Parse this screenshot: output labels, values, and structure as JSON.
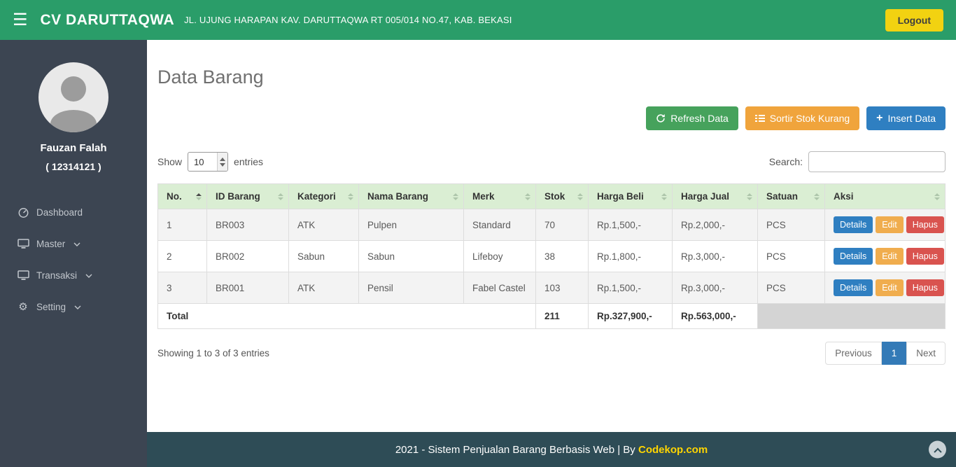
{
  "navbar": {
    "brand": "CV DARUTTAQWA",
    "subtitle": "JL. UJUNG HARAPAN KAV. DARUTTAQWA RT 005/014 NO.47, KAB. BEKASI",
    "logout_label": "Logout"
  },
  "sidebar": {
    "user_name": "Fauzan Falah",
    "user_id": "( 12314121 )",
    "items": [
      {
        "label": "Dashboard"
      },
      {
        "label": "Master"
      },
      {
        "label": "Transaksi"
      },
      {
        "label": "Setting"
      }
    ]
  },
  "main": {
    "page_title": "Data Barang",
    "buttons": {
      "refresh": "Refresh Data",
      "sortir": "Sortir Stok Kurang",
      "insert": "Insert Data"
    },
    "controls": {
      "show_label": "Show",
      "page_length": "10",
      "entries_label": "entries",
      "search_label": "Search:"
    },
    "table": {
      "headers": [
        "No.",
        "ID Barang",
        "Kategori",
        "Nama Barang",
        "Merk",
        "Stok",
        "Harga Beli",
        "Harga Jual",
        "Satuan",
        "Aksi"
      ],
      "rows": [
        {
          "no": "1",
          "id": "BR003",
          "kategori": "ATK",
          "nama": "Pulpen",
          "merk": "Standard",
          "stok": "70",
          "beli": "Rp.1,500,-",
          "jual": "Rp.2,000,-",
          "satuan": "PCS"
        },
        {
          "no": "2",
          "id": "BR002",
          "kategori": "Sabun",
          "nama": "Sabun",
          "merk": "Lifeboy",
          "stok": "38",
          "beli": "Rp.1,800,-",
          "jual": "Rp.3,000,-",
          "satuan": "PCS"
        },
        {
          "no": "3",
          "id": "BR001",
          "kategori": "ATK",
          "nama": "Pensil",
          "merk": "Fabel Castel",
          "stok": "103",
          "beli": "Rp.1,500,-",
          "jual": "Rp.3,000,-",
          "satuan": "PCS"
        }
      ],
      "actions": {
        "details": "Details",
        "edit": "Edit",
        "hapus": "Hapus"
      },
      "total": {
        "label": "Total",
        "stok": "211",
        "beli": "Rp.327,900,-",
        "jual": "Rp.563,000,-"
      }
    },
    "pagination": {
      "info": "Showing 1 to 3 of 3 entries",
      "previous": "Previous",
      "page": "1",
      "next": "Next"
    }
  },
  "footer": {
    "text": "2021 - Sistem Penjualan Barang Berbasis Web | By",
    "link": "Codekop.com"
  },
  "colors": {
    "navbar_green": "#2a9d69",
    "logout_yellow": "#f2d211",
    "sidebar_dark": "#3c4552",
    "footer_teal": "#2e4c56",
    "table_header_green": "#daeed3",
    "btn_refresh_green": "#46a25c",
    "btn_sortir_orange": "#f0a43c",
    "btn_insert_blue": "#2f7fc1",
    "btn_details_blue": "#2f7fc1",
    "btn_edit_orange": "#f0ad4e",
    "btn_hapus_red": "#d9534f",
    "pagination_active_blue": "#337ab7",
    "footer_link_yellow": "#ffd500"
  }
}
